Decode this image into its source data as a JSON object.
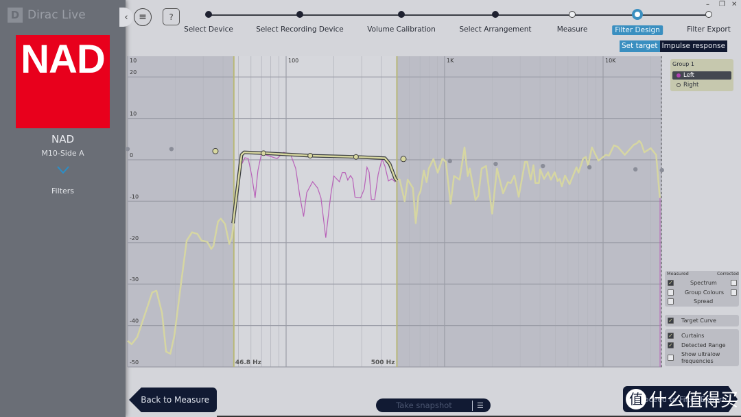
{
  "app": {
    "title": "Dirac Live",
    "logo_letter": "D"
  },
  "sidebar": {
    "brand_logo": "NAD",
    "device_name": "NAD",
    "device_model": "M10-Side A",
    "section": "Filters",
    "accent": "#2a8fc8"
  },
  "toolbar": {
    "collapse_icon": "‹",
    "menu_icon": "≡",
    "help_label": "?"
  },
  "window_controls": [
    "–",
    "❐",
    "✕"
  ],
  "stepper": {
    "steps": [
      {
        "label": "Select Device",
        "state": "done"
      },
      {
        "label": "Select Recording Device",
        "state": "done"
      },
      {
        "label": "Volume Calibration",
        "state": "done"
      },
      {
        "label": "Select Arrangement",
        "state": "done"
      },
      {
        "label": "Measure",
        "state": "todo"
      },
      {
        "label": "Filter Design",
        "state": "active"
      },
      {
        "label": "Filter Export",
        "state": "todo"
      }
    ],
    "subtabs": [
      {
        "label": "Set target",
        "active": true
      },
      {
        "label": "Impulse response",
        "active": false
      }
    ],
    "accent": "#3a8fc0"
  },
  "chart_data": {
    "type": "line",
    "x_scale": "log",
    "xlim": [
      10,
      23500
    ],
    "ylim": [
      -50,
      25
    ],
    "x_ticks": [
      {
        "value": 10,
        "label": "10"
      },
      {
        "value": 100,
        "label": "100"
      },
      {
        "value": 1000,
        "label": "1K"
      },
      {
        "value": 10000,
        "label": "10K"
      }
    ],
    "y_ticks": [
      20,
      10,
      0,
      -10,
      -20,
      -30,
      -40,
      -50
    ],
    "grid": true,
    "curtains": {
      "low": {
        "value": 46.8,
        "label": "46.8 Hz"
      },
      "high": {
        "value": 500,
        "label": "500 Hz"
      }
    },
    "series": [
      {
        "key": "measured_low",
        "color": "#d6d6a2",
        "points": [
          [
            10,
            -43.7
          ],
          [
            10.6,
            -44.5
          ],
          [
            11.5,
            -42.8
          ],
          [
            12.7,
            -37.9
          ],
          [
            14.3,
            -32
          ],
          [
            15.2,
            -31.6
          ],
          [
            16.5,
            -37
          ],
          [
            17.5,
            -46.3
          ],
          [
            18.6,
            -46.8
          ],
          [
            19.7,
            -42.6
          ],
          [
            21.8,
            -29.4
          ],
          [
            23.6,
            -19.5
          ],
          [
            25.5,
            -17.5
          ],
          [
            27.6,
            -17.9
          ],
          [
            29.3,
            -19.5
          ],
          [
            31.8,
            -19.8
          ],
          [
            33.7,
            -21.5
          ],
          [
            34.8,
            -20.8
          ],
          [
            37.2,
            -14.9
          ],
          [
            38.7,
            -14.2
          ],
          [
            41.2,
            -15.5
          ],
          [
            43.8,
            -20.3
          ],
          [
            45.5,
            -18.6
          ],
          [
            46.8,
            -15
          ]
        ]
      },
      {
        "key": "measured_left",
        "color": "#b860b8",
        "points": [
          [
            46.8,
            -15
          ],
          [
            50.8,
            -2.1
          ],
          [
            55,
            0.5
          ],
          [
            57.7,
            0.3
          ],
          [
            60.7,
            -3.8
          ],
          [
            63.7,
            -9.2
          ],
          [
            66.4,
            -2.6
          ],
          [
            69.9,
            1.5
          ],
          [
            77.1,
            1
          ],
          [
            87.7,
            0.3
          ],
          [
            96.6,
            1.8
          ],
          [
            107,
            1.2
          ],
          [
            115,
            -2.1
          ],
          [
            122,
            -8.7
          ],
          [
            129,
            -13.7
          ],
          [
            135,
            -7.9
          ],
          [
            147,
            -5.3
          ],
          [
            158,
            -6.8
          ],
          [
            166,
            -9.2
          ],
          [
            178,
            -18.8
          ],
          [
            191,
            -8.7
          ],
          [
            200,
            -3.9
          ],
          [
            217,
            -5.3
          ],
          [
            226,
            -3.1
          ],
          [
            236,
            -3.1
          ],
          [
            245,
            -4.9
          ],
          [
            255,
            -3.8
          ],
          [
            263,
            -4.6
          ],
          [
            272,
            -9
          ],
          [
            295,
            -9.2
          ],
          [
            311,
            -7.1
          ],
          [
            324,
            -1.8
          ],
          [
            334,
            -3
          ],
          [
            345,
            -9.6
          ],
          [
            362,
            -9.6
          ],
          [
            381,
            -3.5
          ],
          [
            403,
            0.2
          ],
          [
            420,
            -1.5
          ],
          [
            442,
            -5.1
          ],
          [
            465,
            -4.6
          ],
          [
            488,
            -5.4
          ]
        ]
      },
      {
        "key": "measured_high",
        "color": "#d6d6a2",
        "points": [
          [
            495,
            -4.6
          ],
          [
            521,
            -4.8
          ],
          [
            560,
            -10
          ],
          [
            585,
            -4.8
          ],
          [
            631,
            -6.8
          ],
          [
            658,
            -15.3
          ],
          [
            683,
            -8.7
          ],
          [
            705,
            -7.6
          ],
          [
            740,
            -2.6
          ],
          [
            770,
            -5.4
          ],
          [
            795,
            -2.1
          ],
          [
            850,
            0.2
          ],
          [
            905,
            -3.1
          ],
          [
            970,
            0.3
          ],
          [
            1018,
            -0.5
          ],
          [
            1092,
            -10.6
          ],
          [
            1146,
            -3.9
          ],
          [
            1244,
            -4.8
          ],
          [
            1335,
            3
          ],
          [
            1400,
            -3.9
          ],
          [
            1442,
            -2.1
          ],
          [
            1566,
            -9.7
          ],
          [
            1631,
            -8.7
          ],
          [
            1713,
            -2.1
          ],
          [
            1825,
            -1.5
          ],
          [
            1995,
            -13
          ],
          [
            2142,
            -2.1
          ],
          [
            2338,
            -8.1
          ],
          [
            2508,
            -5.4
          ],
          [
            2617,
            -5.6
          ],
          [
            2757,
            -3.8
          ],
          [
            2935,
            -8.9
          ],
          [
            3215,
            -0.5
          ],
          [
            3318,
            -0.5
          ],
          [
            3493,
            -4.8
          ],
          [
            3637,
            -1.3
          ],
          [
            3738,
            -5.6
          ],
          [
            3936,
            -5.6
          ],
          [
            4007,
            -2.3
          ],
          [
            4242,
            -4.6
          ],
          [
            4496,
            -3
          ],
          [
            4685,
            -4.8
          ],
          [
            4948,
            -3
          ],
          [
            5165,
            -5.1
          ],
          [
            5328,
            -4.6
          ],
          [
            5495,
            -6.4
          ],
          [
            5750,
            -3.8
          ],
          [
            6140,
            -5.9
          ],
          [
            6790,
            -1.8
          ],
          [
            7000,
            -3.1
          ],
          [
            7480,
            0.3
          ],
          [
            7770,
            0.7
          ],
          [
            8050,
            -1.3
          ],
          [
            8500,
            3
          ],
          [
            9340,
            -0.2
          ],
          [
            9650,
            0.2
          ],
          [
            10400,
            1.2
          ],
          [
            10900,
            1
          ],
          [
            11700,
            3.5
          ],
          [
            12400,
            3.1
          ],
          [
            13700,
            1.2
          ],
          [
            15600,
            3.6
          ],
          [
            16400,
            4
          ],
          [
            16900,
            4.6
          ],
          [
            17400,
            4
          ],
          [
            18200,
            1.8
          ],
          [
            20000,
            2.8
          ],
          [
            21600,
            1.2
          ],
          [
            22800,
            -9.2
          ]
        ]
      },
      {
        "key": "target_curve",
        "color": "#d8d8a0",
        "points": [
          [
            46.3,
            -15.3
          ],
          [
            52.3,
            1.2
          ],
          [
            54.4,
            1.8
          ],
          [
            72,
            1.6
          ],
          [
            142,
            1
          ],
          [
            276,
            0.7
          ],
          [
            420,
            0.4
          ],
          [
            450,
            -1
          ],
          [
            489,
            -4.6
          ],
          [
            500,
            -5
          ]
        ]
      }
    ],
    "target_handles": [
      [
        72,
        1.6
      ],
      [
        142,
        1
      ],
      [
        276,
        0.7
      ]
    ],
    "outer_handles": [
      [
        35.8,
        2.1
      ],
      [
        550,
        0.2
      ]
    ],
    "inactive_handles": [
      [
        10,
        2.6
      ],
      [
        18.9,
        2.6
      ],
      [
        1080,
        -0.3
      ],
      [
        2100,
        -1
      ],
      [
        4170,
        -1.5
      ],
      [
        8200,
        -1.8
      ],
      [
        16000,
        -2.3
      ],
      [
        23500,
        -2.5
      ]
    ]
  },
  "groups": {
    "title": "Group 1",
    "items": [
      {
        "label": "Left",
        "selected": true,
        "color": "#b040b0"
      },
      {
        "label": "Right",
        "selected": false
      }
    ]
  },
  "display": {
    "measured_header": "Measured",
    "corrected_header": "Corrected",
    "rows": [
      {
        "label": "Spectrum",
        "measured": true,
        "corrected": false
      },
      {
        "label": "Group Colours",
        "measured": false,
        "corrected": false
      },
      {
        "label": "Spread",
        "measured": false
      }
    ],
    "target_curve": {
      "label": "Target Curve",
      "checked": true
    },
    "options": [
      {
        "label": "Curtains",
        "checked": true
      },
      {
        "label": "Detected Range",
        "checked": true
      },
      {
        "label": "Show ultralow frequencies",
        "checked": false
      }
    ]
  },
  "footer": {
    "back_label": "Back to Measure",
    "snapshot_label": "Take snapshot",
    "snapshot_icon": "list-icon",
    "next_label": "Proceed to Filter Export",
    "watermark": "什么值得买",
    "watermark_badge": "值"
  }
}
